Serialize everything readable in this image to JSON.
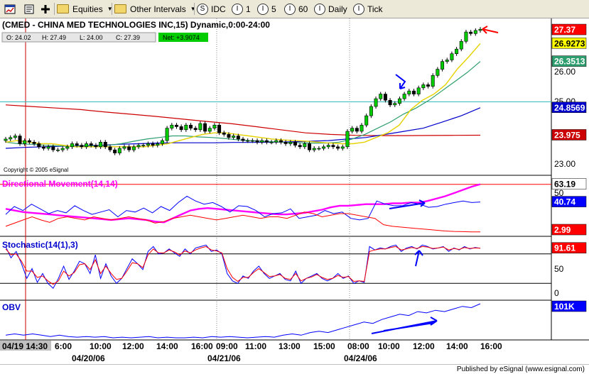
{
  "toolbar": {
    "equities_label": "Equities",
    "intervals_label": "Other Intervals",
    "idc_label": "IDC",
    "one_label": "1",
    "sixty_label": "60",
    "daily_label": "Daily",
    "tick_label": "Tick"
  },
  "chart_title": "(CMED - CHINA MED TECHNOLOGIES INC,15) Dynamic,0:00-24:00",
  "ohlc": {
    "open": "O: 24.02",
    "high": "H: 27.49",
    "low": "L: 24.00",
    "close": "C: 27.39",
    "net": "Net: +3.9074"
  },
  "copyright": "Copyright © 2005 eSignal",
  "credit": "Published by eSignal (www.esignal.com)",
  "colors": {
    "candle_up": "#00cc00",
    "candle_down": "#000000",
    "ma_yellow": "#e6d200",
    "ma_green": "#2e9e6e",
    "ma_blue": "#0000cc",
    "ma_red": "#cc0000",
    "horizontal_cyan": "#33bbbb",
    "dmi_magenta": "#ff00ff",
    "stoch_blue": "#0000ff",
    "stoch_red": "#ff0000",
    "obv_blue": "#0000ff"
  },
  "chart_data": [
    {
      "type": "candlestick",
      "title": "(CMED - CHINA MED TECHNOLOGIES INC,15) Dynamic,0:00-24:00",
      "ylim": [
        22.75,
        27.6
      ],
      "yticks": [
        "23.00",
        "24.00",
        "25.00",
        "26.00"
      ],
      "price_labels": [
        {
          "label": "27.37",
          "value": 27.37,
          "color": "#ff0000",
          "text_color": "#ffffff"
        },
        {
          "label": "26.9273",
          "value": 26.93,
          "color": "#ffff00",
          "text_color": "#000000"
        },
        {
          "label": "26.3513",
          "value": 26.35,
          "color": "#2e9e6e",
          "text_color": "#ffffff"
        },
        {
          "label": "24.8569",
          "value": 24.86,
          "color": "#0000cc",
          "text_color": "#ffffff"
        },
        {
          "label": "23.975",
          "value": 23.975,
          "color": "#cc0000",
          "text_color": "#ffffff"
        }
      ],
      "closes": [
        23.85,
        23.9,
        23.95,
        23.7,
        23.8,
        23.75,
        23.7,
        23.6,
        23.55,
        23.6,
        23.5,
        23.5,
        23.55,
        23.6,
        23.7,
        23.65,
        23.6,
        23.7,
        23.65,
        23.6,
        23.75,
        23.6,
        23.5,
        23.4,
        23.55,
        23.6,
        23.5,
        23.6,
        23.65,
        23.65,
        23.7,
        23.65,
        23.7,
        23.8,
        24.2,
        24.3,
        24.25,
        24.15,
        24.3,
        24.2,
        24.15,
        24.35,
        24.1,
        24.2,
        24.3,
        24.05,
        24.0,
        23.9,
        23.95,
        23.85,
        23.8,
        23.8,
        23.8,
        23.75,
        23.8,
        23.75,
        23.75,
        23.8,
        23.75,
        23.7,
        23.75,
        23.65,
        23.6,
        23.7,
        23.5,
        23.55,
        23.55,
        23.6,
        23.65,
        23.6,
        23.55,
        23.6,
        24.1,
        24.2,
        24.1,
        24.3,
        24.6,
        24.9,
        25.15,
        25.3,
        25.1,
        24.95,
        25.0,
        25.15,
        25.3,
        25.4,
        25.3,
        25.5,
        25.6,
        25.55,
        25.9,
        26.1,
        26.35,
        26.4,
        26.6,
        26.75,
        27.0,
        27.3,
        27.25,
        27.35,
        27.39
      ],
      "ma_yellow": [
        23.75,
        23.8,
        23.75,
        23.7,
        23.7,
        23.65,
        23.6,
        23.6,
        23.6,
        23.6,
        23.6,
        23.6,
        23.6,
        23.65,
        23.7,
        23.8,
        23.9,
        24.0,
        24.05,
        24.05,
        24.0,
        23.95,
        23.9,
        23.85,
        23.82,
        23.8,
        23.78,
        23.75,
        23.72,
        23.7,
        23.7,
        23.75,
        23.9,
        24.05,
        24.3,
        24.8,
        25.1,
        25.3,
        25.6,
        26.1,
        26.5,
        26.93
      ],
      "ma_green": [
        23.75,
        23.7,
        23.68,
        23.65,
        23.63,
        23.62,
        23.62,
        23.63,
        23.65,
        23.7,
        23.78,
        23.85,
        23.9,
        23.95,
        23.95,
        23.92,
        23.9,
        23.87,
        23.83,
        23.8,
        23.78,
        23.76,
        23.74,
        23.73,
        23.72,
        23.72,
        23.75,
        23.85,
        24.0,
        24.2,
        24.4,
        24.65,
        24.85,
        25.1,
        25.4,
        25.7,
        26.0,
        26.35
      ],
      "ma_blue": [
        23.55,
        23.58,
        23.6,
        23.62,
        23.63,
        23.65,
        23.68,
        23.7,
        23.72,
        23.73,
        23.73,
        23.73,
        23.74,
        23.74,
        23.75,
        23.76,
        23.78,
        23.8,
        23.85,
        23.9,
        24.0,
        24.1,
        24.2,
        24.4,
        24.6,
        24.86
      ],
      "ma_red": [
        24.95,
        24.9,
        24.85,
        24.8,
        24.72,
        24.65,
        24.58,
        24.5,
        24.42,
        24.35,
        24.25,
        24.15,
        24.05,
        24.0,
        23.97,
        23.96,
        23.96,
        23.965,
        23.97,
        23.975
      ],
      "cyan_level": 25.05
    },
    {
      "type": "line",
      "title": "Directional Movement(14,14)",
      "ylim": [
        0,
        70
      ],
      "yticks": [
        "50"
      ],
      "level": 63,
      "labels": [
        {
          "label": "63.19",
          "value": 63.19,
          "color": "#ffffff",
          "text_color": "#000000"
        },
        {
          "label": "40.74",
          "value": 40.74,
          "color": "#0000ff",
          "text_color": "#ffffff"
        },
        {
          "label": "2.99",
          "value": 2.99,
          "color": "#ff0000",
          "text_color": "#ffffff"
        }
      ],
      "series": [
        {
          "color": "#ff00ff",
          "values": [
            32,
            30,
            28,
            27,
            26,
            25,
            24,
            23,
            22,
            21,
            20,
            19,
            18,
            19,
            20,
            19,
            18,
            16,
            15,
            20,
            25,
            30,
            32,
            33,
            32,
            31,
            30,
            29,
            28,
            27,
            26,
            25,
            25,
            26,
            27,
            29,
            31,
            34,
            36,
            36,
            37,
            38,
            38,
            38,
            39,
            39,
            40,
            40,
            42,
            45,
            48,
            52,
            56,
            60,
            63.19
          ]
        },
        {
          "color": "#0000ff",
          "values": [
            25,
            35,
            30,
            38,
            32,
            26,
            30,
            27,
            36,
            30,
            25,
            28,
            31,
            22,
            30,
            28,
            33,
            27,
            35,
            30,
            40,
            48,
            42,
            38,
            40,
            35,
            28,
            36,
            35,
            30,
            22,
            26,
            27,
            32,
            20,
            22,
            24,
            30,
            26,
            28,
            20,
            18,
            20,
            42,
            38,
            36,
            36,
            40,
            38,
            34,
            35,
            38,
            40,
            42,
            40,
            40.74
          ]
        },
        {
          "color": "#ff0000",
          "values": [
            10,
            14,
            18,
            22,
            18,
            15,
            20,
            22,
            20,
            18,
            22,
            20,
            18,
            20,
            22,
            20,
            18,
            14,
            16,
            20,
            22,
            24,
            22,
            20,
            18,
            20,
            22,
            24,
            22,
            20,
            22,
            22,
            20,
            24,
            28,
            26,
            22,
            24,
            26,
            26,
            24,
            22,
            20,
            12,
            10,
            9,
            8,
            7,
            6,
            5,
            4,
            3.5,
            3.2,
            3.0,
            2.99
          ]
        }
      ]
    },
    {
      "type": "line",
      "title": "Stochastic(14(1),3)",
      "ylim": [
        -10,
        110
      ],
      "yticks": [
        "50",
        "0"
      ],
      "levels": [
        80,
        20
      ],
      "labels": [
        {
          "label": "91.61",
          "value": 91.61,
          "color": "#ff0000",
          "text_color": "#ffffff"
        }
      ],
      "series": [
        {
          "color": "#0000ff",
          "values": [
            95,
            72,
            85,
            60,
            30,
            50,
            22,
            40,
            20,
            10,
            30,
            55,
            28,
            45,
            65,
            60,
            40,
            78,
            30,
            60,
            35,
            20,
            30,
            50,
            70,
            60,
            48,
            85,
            95,
            80,
            82,
            90,
            82,
            75,
            90,
            80,
            92,
            95,
            98,
            85,
            88,
            80,
            40,
            25,
            20,
            35,
            30,
            45,
            55,
            40,
            30,
            35,
            40,
            28,
            25,
            45,
            20,
            30,
            35,
            40,
            30,
            25,
            30,
            40,
            30,
            35,
            20,
            25,
            22,
            95,
            88,
            92,
            90,
            95,
            98,
            85,
            92,
            95,
            90,
            98,
            95,
            90,
            92,
            95,
            85,
            92,
            88,
            95,
            90,
            93,
            91.61
          ]
        },
        {
          "color": "#ff0000",
          "values": [
            90,
            78,
            80,
            65,
            45,
            45,
            32,
            35,
            25,
            18,
            25,
            45,
            35,
            42,
            58,
            60,
            48,
            68,
            40,
            55,
            40,
            28,
            30,
            45,
            62,
            60,
            52,
            78,
            90,
            82,
            82,
            88,
            84,
            78,
            86,
            82,
            88,
            92,
            95,
            88,
            86,
            82,
            50,
            32,
            24,
            32,
            32,
            42,
            50,
            42,
            34,
            35,
            38,
            30,
            28,
            40,
            25,
            30,
            33,
            38,
            32,
            28,
            30,
            36,
            32,
            34,
            24,
            25,
            24,
            85,
            88,
            90,
            90,
            93,
            95,
            88,
            90,
            93,
            91,
            95,
            94,
            91,
            92,
            94,
            88,
            91,
            89,
            93,
            91,
            92,
            91.61
          ]
        }
      ]
    },
    {
      "type": "line",
      "title": "OBV",
      "labels": [
        {
          "label": "101K",
          "value": 101,
          "color": "#0000ff",
          "text_color": "#ffffff"
        }
      ],
      "series": [
        {
          "color": "#0000ff",
          "values": [
            2,
            3,
            2,
            3,
            2,
            1,
            2,
            1,
            0.5,
            1,
            0.5,
            1,
            0,
            0.5,
            0,
            0.5,
            1,
            0,
            0.5,
            0,
            0,
            0.5,
            0,
            1,
            0.5,
            1,
            0.5,
            0,
            0.5,
            1,
            0.5,
            2,
            3,
            2,
            4,
            5,
            4,
            6,
            8,
            10,
            12,
            11,
            14,
            16,
            18,
            17,
            20,
            19,
            21,
            20,
            22,
            24,
            23,
            26
          ]
        }
      ]
    }
  ],
  "x_axis": {
    "session_start_label": "04/19 14:30",
    "time_ticks": [
      "6:00",
      "10:00",
      "12:00",
      "14:00",
      "16:00",
      "09:00",
      "11:00",
      "13:00",
      "15:00",
      "08:00",
      "10:00",
      "12:00",
      "14:00",
      "16:00"
    ],
    "dates": [
      "04/20/06",
      "04/21/06",
      "04/24/06"
    ]
  }
}
